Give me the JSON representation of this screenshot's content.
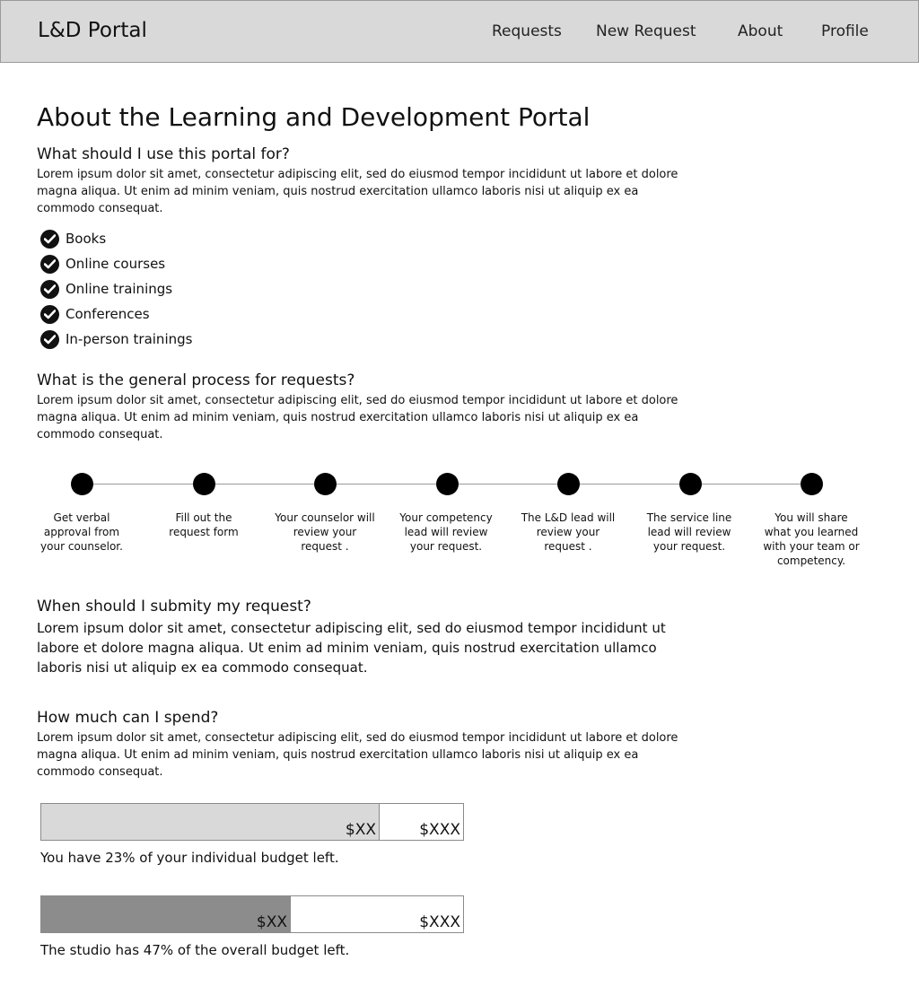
{
  "header": {
    "brand": "L&D Portal",
    "nav": [
      "Requests",
      "New Request",
      "About",
      "Profile"
    ]
  },
  "page": {
    "title": "About the Learning and Development Portal"
  },
  "sections": {
    "use": {
      "heading": "What should I use this portal for?",
      "body": "Lorem ipsum dolor sit amet, consectetur adipiscing elit, sed do eiusmod tempor incididunt ut labore et dolore magna aliqua. Ut enim ad minim veniam, quis nostrud exercitation ullamco laboris nisi ut aliquip ex ea commodo consequat.",
      "items": [
        "Books",
        "Online courses",
        "Online trainings",
        "Conferences",
        "In-person trainings"
      ]
    },
    "process": {
      "heading": "What is the general process for requests?",
      "body": "Lorem ipsum dolor sit amet, consectetur adipiscing elit, sed do eiusmod tempor incididunt ut labore et dolore magna aliqua. Ut enim ad minim veniam, quis nostrud exercitation ullamco laboris nisi ut aliquip ex ea commodo consequat.",
      "steps": [
        "Get verbal approval from your counselor.",
        "Fill out the request form",
        "Your counselor will review your request .",
        "Your competency lead will review your request.",
        "The L&D lead will review your request .",
        "The service line lead will review your request.",
        "You will share what you learned with your team or competency."
      ]
    },
    "when": {
      "heading": "When should I submity my request?",
      "body": "Lorem ipsum dolor sit amet, consectetur adipiscing elit, sed do eiusmod tempor incididunt ut labore et dolore magna aliqua. Ut enim ad minim veniam, quis nostrud exercitation ullamco laboris nisi ut aliquip ex ea commodo consequat."
    },
    "spend": {
      "heading": "How much can I spend?",
      "body": "Lorem ipsum dolor sit amet, consectetur adipiscing elit, sed do eiusmod tempor incididunt ut labore et dolore magna aliqua. Ut enim ad minim veniam, quis nostrud exercitation ullamco laboris nisi ut aliquip ex ea commodo consequat.",
      "budgets": [
        {
          "fill_fraction": 0.8,
          "fill_color": "#d9d9d9",
          "fill_label": "$XX",
          "total_label": "$XXX",
          "caption": "You have 23% of your individual budget left."
        },
        {
          "fill_fraction": 0.59,
          "fill_color": "#8c8c8c",
          "fill_label": "$XX",
          "total_label": "$XXX",
          "caption": "The studio has 47% of the overall budget left."
        }
      ]
    }
  }
}
